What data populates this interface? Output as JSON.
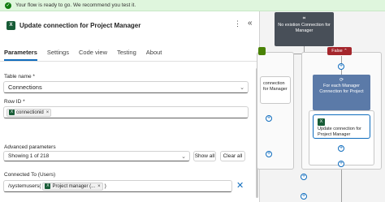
{
  "banner": {
    "message": "Your flow is ready to go. We recommend you test it."
  },
  "panel": {
    "title": "Update connection for Project Manager",
    "tabs": [
      "Parameters",
      "Settings",
      "Code view",
      "Testing",
      "About"
    ],
    "table_name_label": "Table name *",
    "table_name_value": "Connections",
    "row_id_label": "Row ID *",
    "row_id_token": "connectionid",
    "advanced_label": "Advanced parameters",
    "advanced_value": "Showing 1 of 218",
    "show_all": "Show all",
    "clear_all": "Clear all",
    "connected_to_label": "Connected To (Users)",
    "connected_prefix": "/systemusers(",
    "connected_token": "Project manager (...",
    "connected_suffix": ")"
  },
  "canvas": {
    "condition_title": "No existion Connection for Manager",
    "false_label": "False",
    "left_card_text": "connection for Manager",
    "foreach_title": "For each Manager Connection for Project",
    "update_card_text": "Update connection for Project Manager"
  },
  "colors": {
    "banner_bg": "#dff6dd",
    "accent": "#0f6cbd",
    "excel_green": "#185c37",
    "false_red": "#a4262c"
  }
}
